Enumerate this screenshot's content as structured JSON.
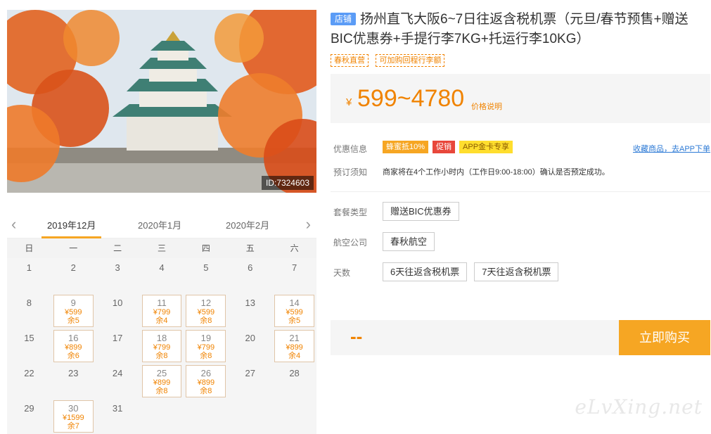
{
  "photo": {
    "id_label": "ID:7324603"
  },
  "calendar": {
    "months": [
      "2019年12月",
      "2020年1月",
      "2020年2月"
    ],
    "weekdays": [
      "日",
      "一",
      "二",
      "三",
      "四",
      "五",
      "六"
    ],
    "days": [
      {
        "day": "1"
      },
      {
        "day": "2"
      },
      {
        "day": "3"
      },
      {
        "day": "4"
      },
      {
        "day": "5"
      },
      {
        "day": "6"
      },
      {
        "day": "7"
      },
      {
        "day": "8"
      },
      {
        "day": "9",
        "price": "¥599",
        "stock": "余5"
      },
      {
        "day": "10"
      },
      {
        "day": "11",
        "price": "¥799",
        "stock": "余4"
      },
      {
        "day": "12",
        "price": "¥599",
        "stock": "余8"
      },
      {
        "day": "13"
      },
      {
        "day": "14",
        "price": "¥599",
        "stock": "余5"
      },
      {
        "day": "15"
      },
      {
        "day": "16",
        "price": "¥899",
        "stock": "余6"
      },
      {
        "day": "17"
      },
      {
        "day": "18",
        "price": "¥799",
        "stock": "余8"
      },
      {
        "day": "19",
        "price": "¥799",
        "stock": "余8"
      },
      {
        "day": "20"
      },
      {
        "day": "21",
        "price": "¥899",
        "stock": "余4"
      },
      {
        "day": "22"
      },
      {
        "day": "23"
      },
      {
        "day": "24"
      },
      {
        "day": "25",
        "price": "¥899",
        "stock": "余8"
      },
      {
        "day": "26",
        "price": "¥899",
        "stock": "余8"
      },
      {
        "day": "27"
      },
      {
        "day": "28"
      },
      {
        "day": "29"
      },
      {
        "day": "30",
        "price": "¥1599",
        "stock": "余7"
      },
      {
        "day": "31"
      }
    ]
  },
  "product": {
    "shop_badge": "店铺",
    "title": "扬州直飞大阪6~7日往返含税机票（元旦/春节预售+赠送BIC优惠券+手提行李7KG+托运行李10KG）",
    "tags": [
      "春秋直营",
      "可加购回程行李额"
    ],
    "currency": "¥",
    "price": "599~4780",
    "price_note": "价格说明"
  },
  "promo": {
    "label": "优惠信息",
    "badges": [
      "蜂蜜抵10%",
      "促销",
      "APP金卡专享"
    ],
    "favorite_link": "收藏商品，去APP下单"
  },
  "booking": {
    "label": "预订须知",
    "text": "商家将在4个工作小时内（工作日9:00-18:00）确认是否预定成功。"
  },
  "options": {
    "package": {
      "label": "套餐类型",
      "items": [
        "赠送BIC优惠券"
      ]
    },
    "airline": {
      "label": "航空公司",
      "items": [
        "春秋航空"
      ]
    },
    "days": {
      "label": "天数",
      "items": [
        "6天往返含税机票",
        "7天往返含税机票"
      ]
    }
  },
  "buy": {
    "total": "--",
    "button": "立即购买"
  },
  "watermark": "eLvXing.net",
  "colors": {
    "accent": "#f6a623",
    "price": "#f08300",
    "link": "#2e7bd6"
  }
}
